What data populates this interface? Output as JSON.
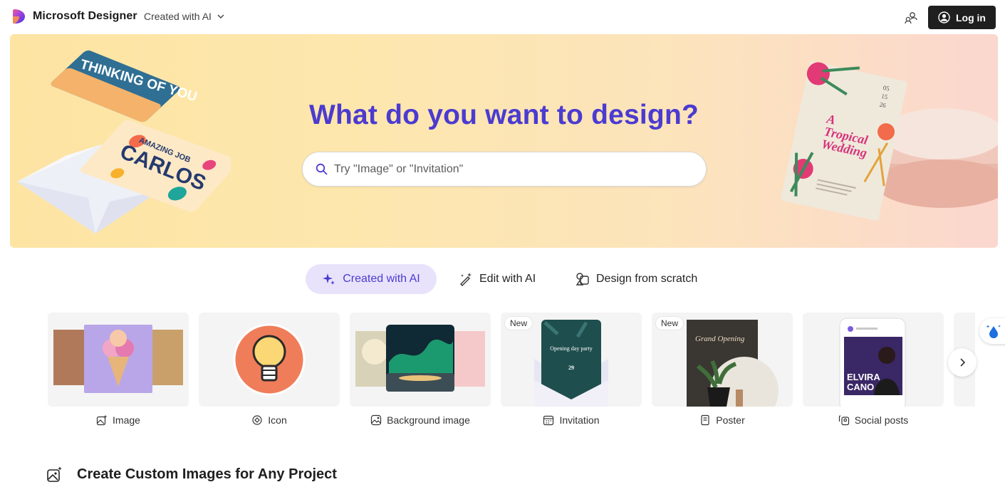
{
  "app": {
    "name": "Microsoft Designer"
  },
  "header": {
    "mode_label": "Created with AI",
    "login_label": "Log in"
  },
  "hero": {
    "title": "What do you want to design?",
    "search_placeholder": "Try \"Image\" or \"Invitation\"",
    "deco_card_text": "THINKING OF YOU",
    "deco_card2_line1": "AMAZING JOB",
    "deco_card2_line2": "CARLOS",
    "wedding_dates": [
      "05",
      "15",
      "26"
    ],
    "wedding_title_line1": "A",
    "wedding_title_line2": "Tropical",
    "wedding_title_line3": "Wedding"
  },
  "tabs": [
    {
      "label": "Created with AI",
      "active": true
    },
    {
      "label": "Edit with AI",
      "active": false
    },
    {
      "label": "Design from scratch",
      "active": false
    }
  ],
  "cards": [
    {
      "label": "Image",
      "badge": ""
    },
    {
      "label": "Icon",
      "badge": ""
    },
    {
      "label": "Background image",
      "badge": ""
    },
    {
      "label": "Invitation",
      "badge": "New",
      "thumb_text": "Opening day party",
      "thumb_date": "29"
    },
    {
      "label": "Poster",
      "badge": "New",
      "thumb_text": "Grand Opening"
    },
    {
      "label": "Social posts",
      "badge": "",
      "thumb_text_1": "ELVIRA",
      "thumb_text_2": "CANO"
    }
  ],
  "section": {
    "title": "Create Custom Images for Any Project"
  },
  "colors": {
    "accent": "#4b3bd0",
    "hero_start": "#fde4a3",
    "hero_end": "#fbd7cf",
    "login_bg": "#1f1f1f",
    "tab_active_bg": "#e8e3fb"
  }
}
